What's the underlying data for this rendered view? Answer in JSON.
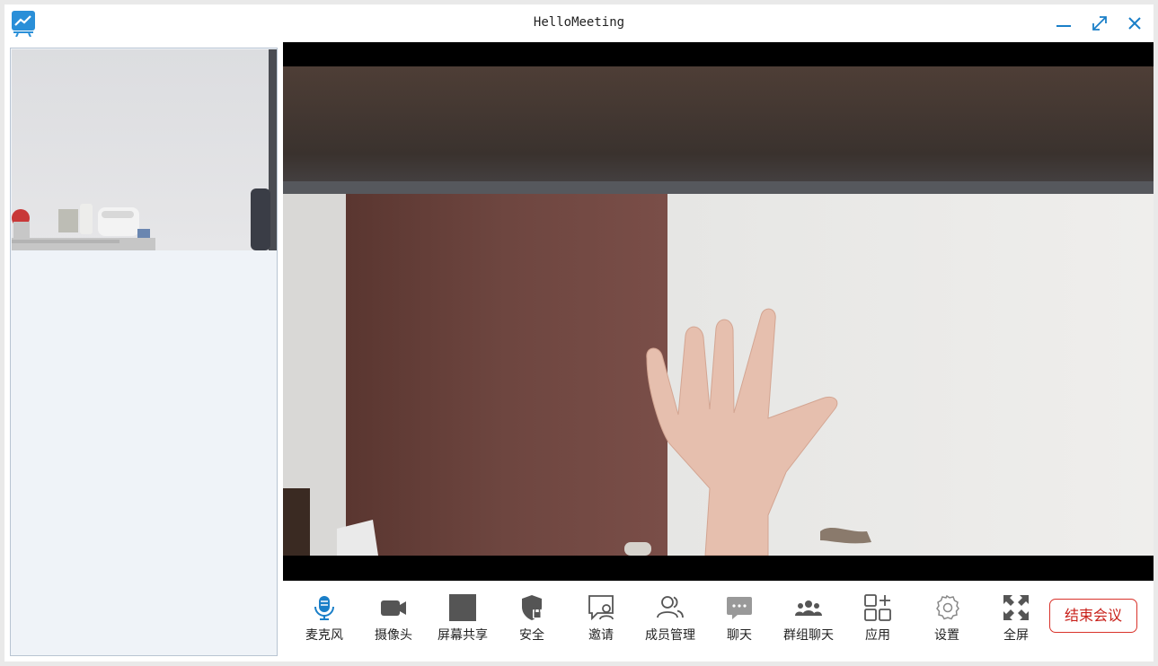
{
  "window": {
    "title": "HelloMeeting"
  },
  "toolbar": {
    "items": [
      {
        "label": "麦克风",
        "icon": "microphone-icon",
        "color": "#1a7fc8"
      },
      {
        "label": "摄像头",
        "icon": "camera-icon"
      },
      {
        "label": "屏幕共享",
        "icon": "screen-share-icon"
      },
      {
        "label": "安全",
        "icon": "shield-lock-icon"
      },
      {
        "label": "邀请",
        "icon": "invite-icon"
      },
      {
        "label": "成员管理",
        "icon": "members-icon"
      },
      {
        "label": "聊天",
        "icon": "chat-icon"
      },
      {
        "label": "群组聊天",
        "icon": "group-chat-icon"
      },
      {
        "label": "应用",
        "icon": "apps-icon"
      },
      {
        "label": "设置",
        "icon": "settings-icon"
      },
      {
        "label": "全屏",
        "icon": "fullscreen-icon"
      }
    ],
    "end_label": "结束会议"
  },
  "colors": {
    "accent": "#1a7fc8",
    "end_meeting": "#c8201a",
    "icon_gray": "#555555"
  }
}
